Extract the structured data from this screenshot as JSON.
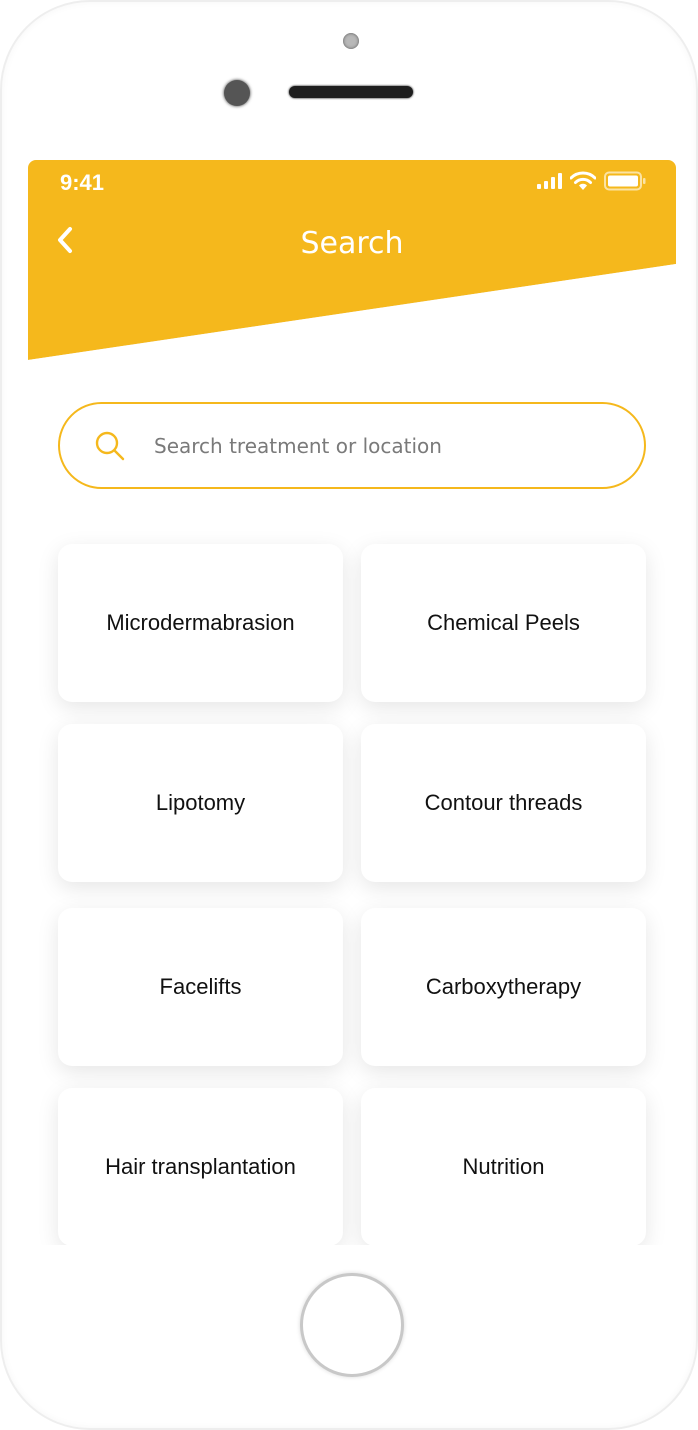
{
  "status_bar": {
    "time": "9:41",
    "icons": [
      "signal-icon",
      "wifi-icon",
      "battery-icon"
    ]
  },
  "header": {
    "title": "Search",
    "back_icon": "chevron-left-icon",
    "color": "#f5b81c"
  },
  "search": {
    "placeholder": "Search treatment or location",
    "value": "",
    "icon": "search-icon"
  },
  "treatments": [
    {
      "label": "Microdermabrasion"
    },
    {
      "label": "Chemical Peels"
    },
    {
      "label": "Lipotomy"
    },
    {
      "label": "Contour threads"
    },
    {
      "label": "Facelifts"
    },
    {
      "label": "Carboxytherapy"
    },
    {
      "label": "Hair transplantation"
    },
    {
      "label": "Nutrition"
    }
  ]
}
